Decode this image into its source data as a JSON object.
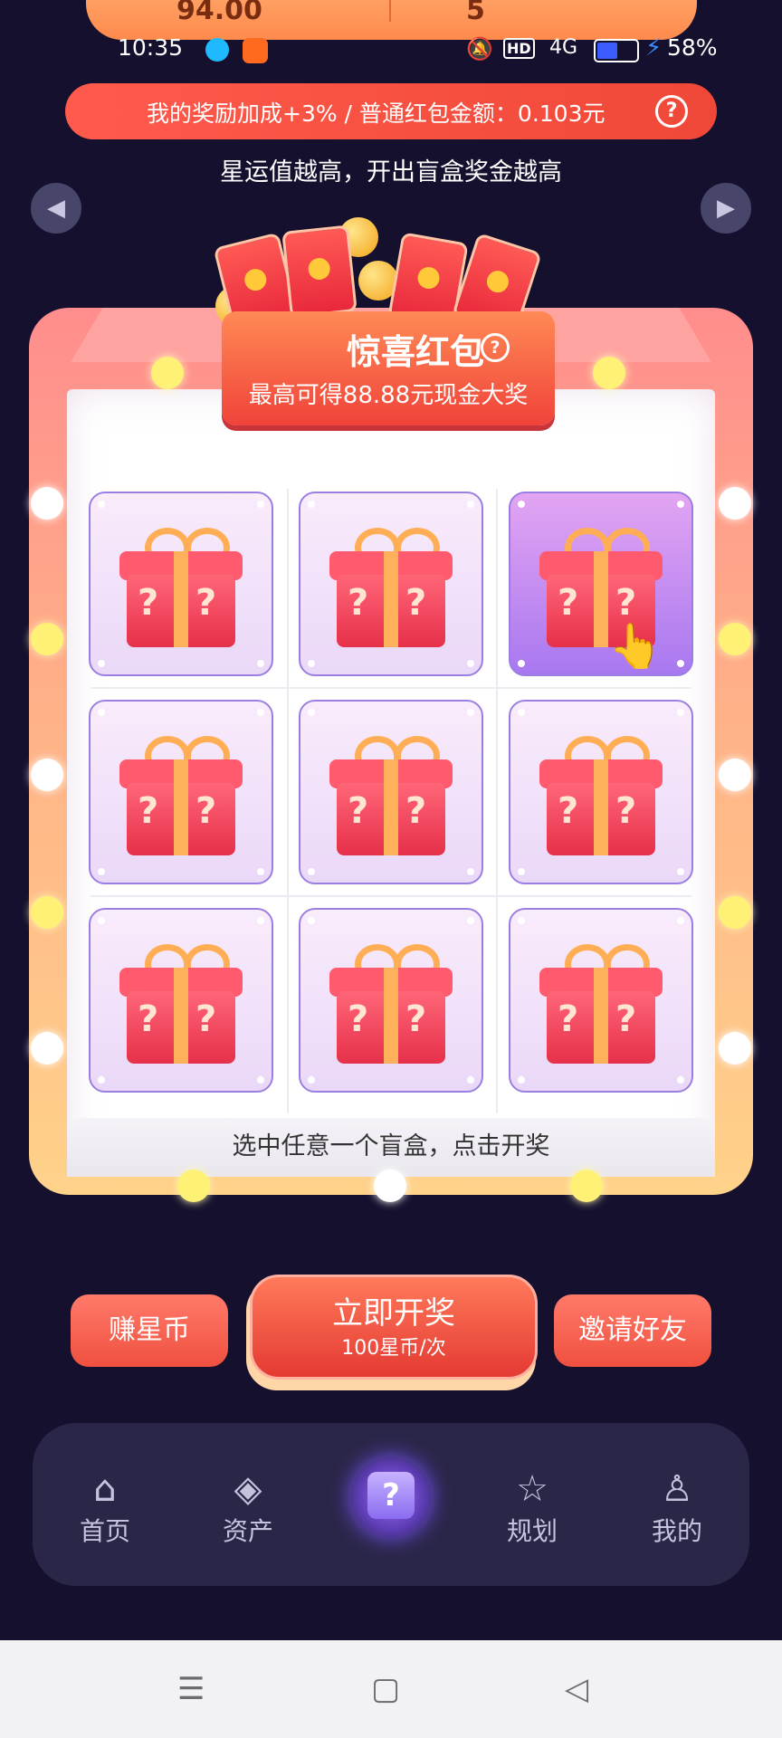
{
  "top_banner": {
    "left_value": "94.00",
    "right_value": "5"
  },
  "status_bar": {
    "time": "10:35",
    "battery_pct": "58%",
    "battery_level": 0.58,
    "hd_label": "HD",
    "signal_label": "4G"
  },
  "reward": {
    "text": "我的奖励加成+3% / 普通红包金额：0.103元",
    "help_glyph": "?"
  },
  "subtitle": "星运值越高，开出盲盒奖金越高",
  "carousel": {
    "prev_glyph": "◀",
    "next_glyph": "▶"
  },
  "badge": {
    "title": "惊喜红包",
    "help_glyph": "?",
    "subtitle": "最高可得88.88元现金大奖"
  },
  "grid": {
    "question_glyph": "?",
    "cells": [
      {
        "selected": false
      },
      {
        "selected": false
      },
      {
        "selected": true
      },
      {
        "selected": false
      },
      {
        "selected": false
      },
      {
        "selected": false
      },
      {
        "selected": false
      },
      {
        "selected": false
      },
      {
        "selected": false
      }
    ]
  },
  "hint": "选中任意一个盲盒，点击开奖",
  "actions": {
    "earn_label": "赚星币",
    "draw_label": "立即开奖",
    "draw_cost": "100星币/次",
    "invite_label": "邀请好友"
  },
  "tabs": [
    {
      "label": "首页",
      "icon": "home-icon",
      "glyph": "⌂"
    },
    {
      "label": "资产",
      "icon": "assets-icon",
      "glyph": "◈"
    },
    {
      "label": "",
      "icon": "blind-box-icon",
      "glyph": "?"
    },
    {
      "label": "规划",
      "icon": "plan-icon",
      "glyph": "☆"
    },
    {
      "label": "我的",
      "icon": "profile-icon",
      "glyph": "♙"
    }
  ],
  "system_nav": {
    "menu": "☰",
    "home": "▢",
    "back": "◁"
  },
  "colors": {
    "background": "#15102e",
    "accent_red": "#f0503f",
    "accent_orange": "#ff8a55",
    "cell_border": "#9b7fe0",
    "battery_fill": "#3a5cff"
  }
}
